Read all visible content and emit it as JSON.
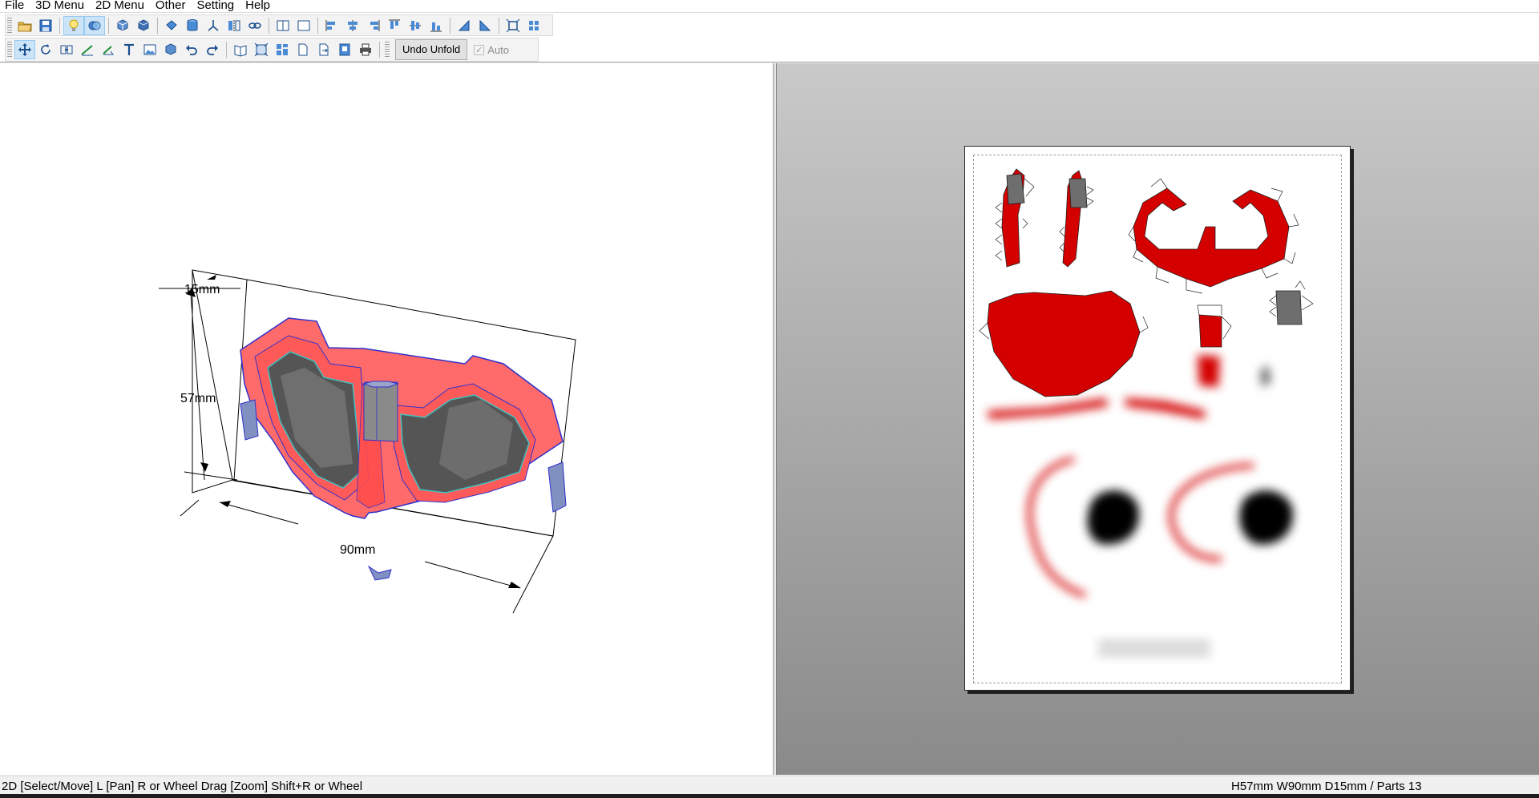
{
  "menu": {
    "items": [
      "File",
      "3D Menu",
      "2D Menu",
      "Other",
      "Setting",
      "Help"
    ]
  },
  "toolbar": {
    "row1_icons": [
      "open-file-icon",
      "save-icon",
      "light-bulb-icon",
      "texture-toggle-icon",
      "cube-view-icon",
      "cube-alt-view-icon",
      "paint-bucket-icon",
      "cylinder-icon",
      "axes-icon",
      "flip-icon",
      "link-icon",
      "single-pane-icon",
      "dual-pane-icon",
      "align-left-icon",
      "align-center-icon",
      "align-right-icon",
      "align-top-icon",
      "align-middle-icon",
      "align-bottom-icon",
      "rotate-left-icon",
      "rotate-right-icon",
      "fit-icon",
      "fit-all-icon"
    ],
    "row2_icons": [
      "select-move-icon",
      "rotate-part-icon",
      "join-icon",
      "edge-tool-icon",
      "flap-tool-icon",
      "text-tool-icon",
      "image-tool-icon",
      "box-tool-icon",
      "undo-icon",
      "redo-icon",
      "unfold-book-icon",
      "grid-icon",
      "pattern-icon",
      "page-icon",
      "export-icon",
      "print-preview-icon",
      "print-icon"
    ],
    "undo_unfold_label": "Undo Unfold",
    "auto_label": "Auto",
    "auto_checked": true
  },
  "viewport3d": {
    "dim_depth": "15mm",
    "dim_height": "57mm",
    "dim_width": "90mm"
  },
  "colors": {
    "model_red": "#ff6b6b",
    "part_red": "#d40000",
    "part_gray": "#6e6e6e",
    "edge_blue": "#3030cc",
    "edge_cyan": "#40c0c0"
  },
  "statusbar": {
    "left": "2D [Select/Move] L [Pan] R or Wheel Drag [Zoom] Shift+R or Wheel",
    "right": "H57mm W90mm D15mm / Parts 13"
  }
}
